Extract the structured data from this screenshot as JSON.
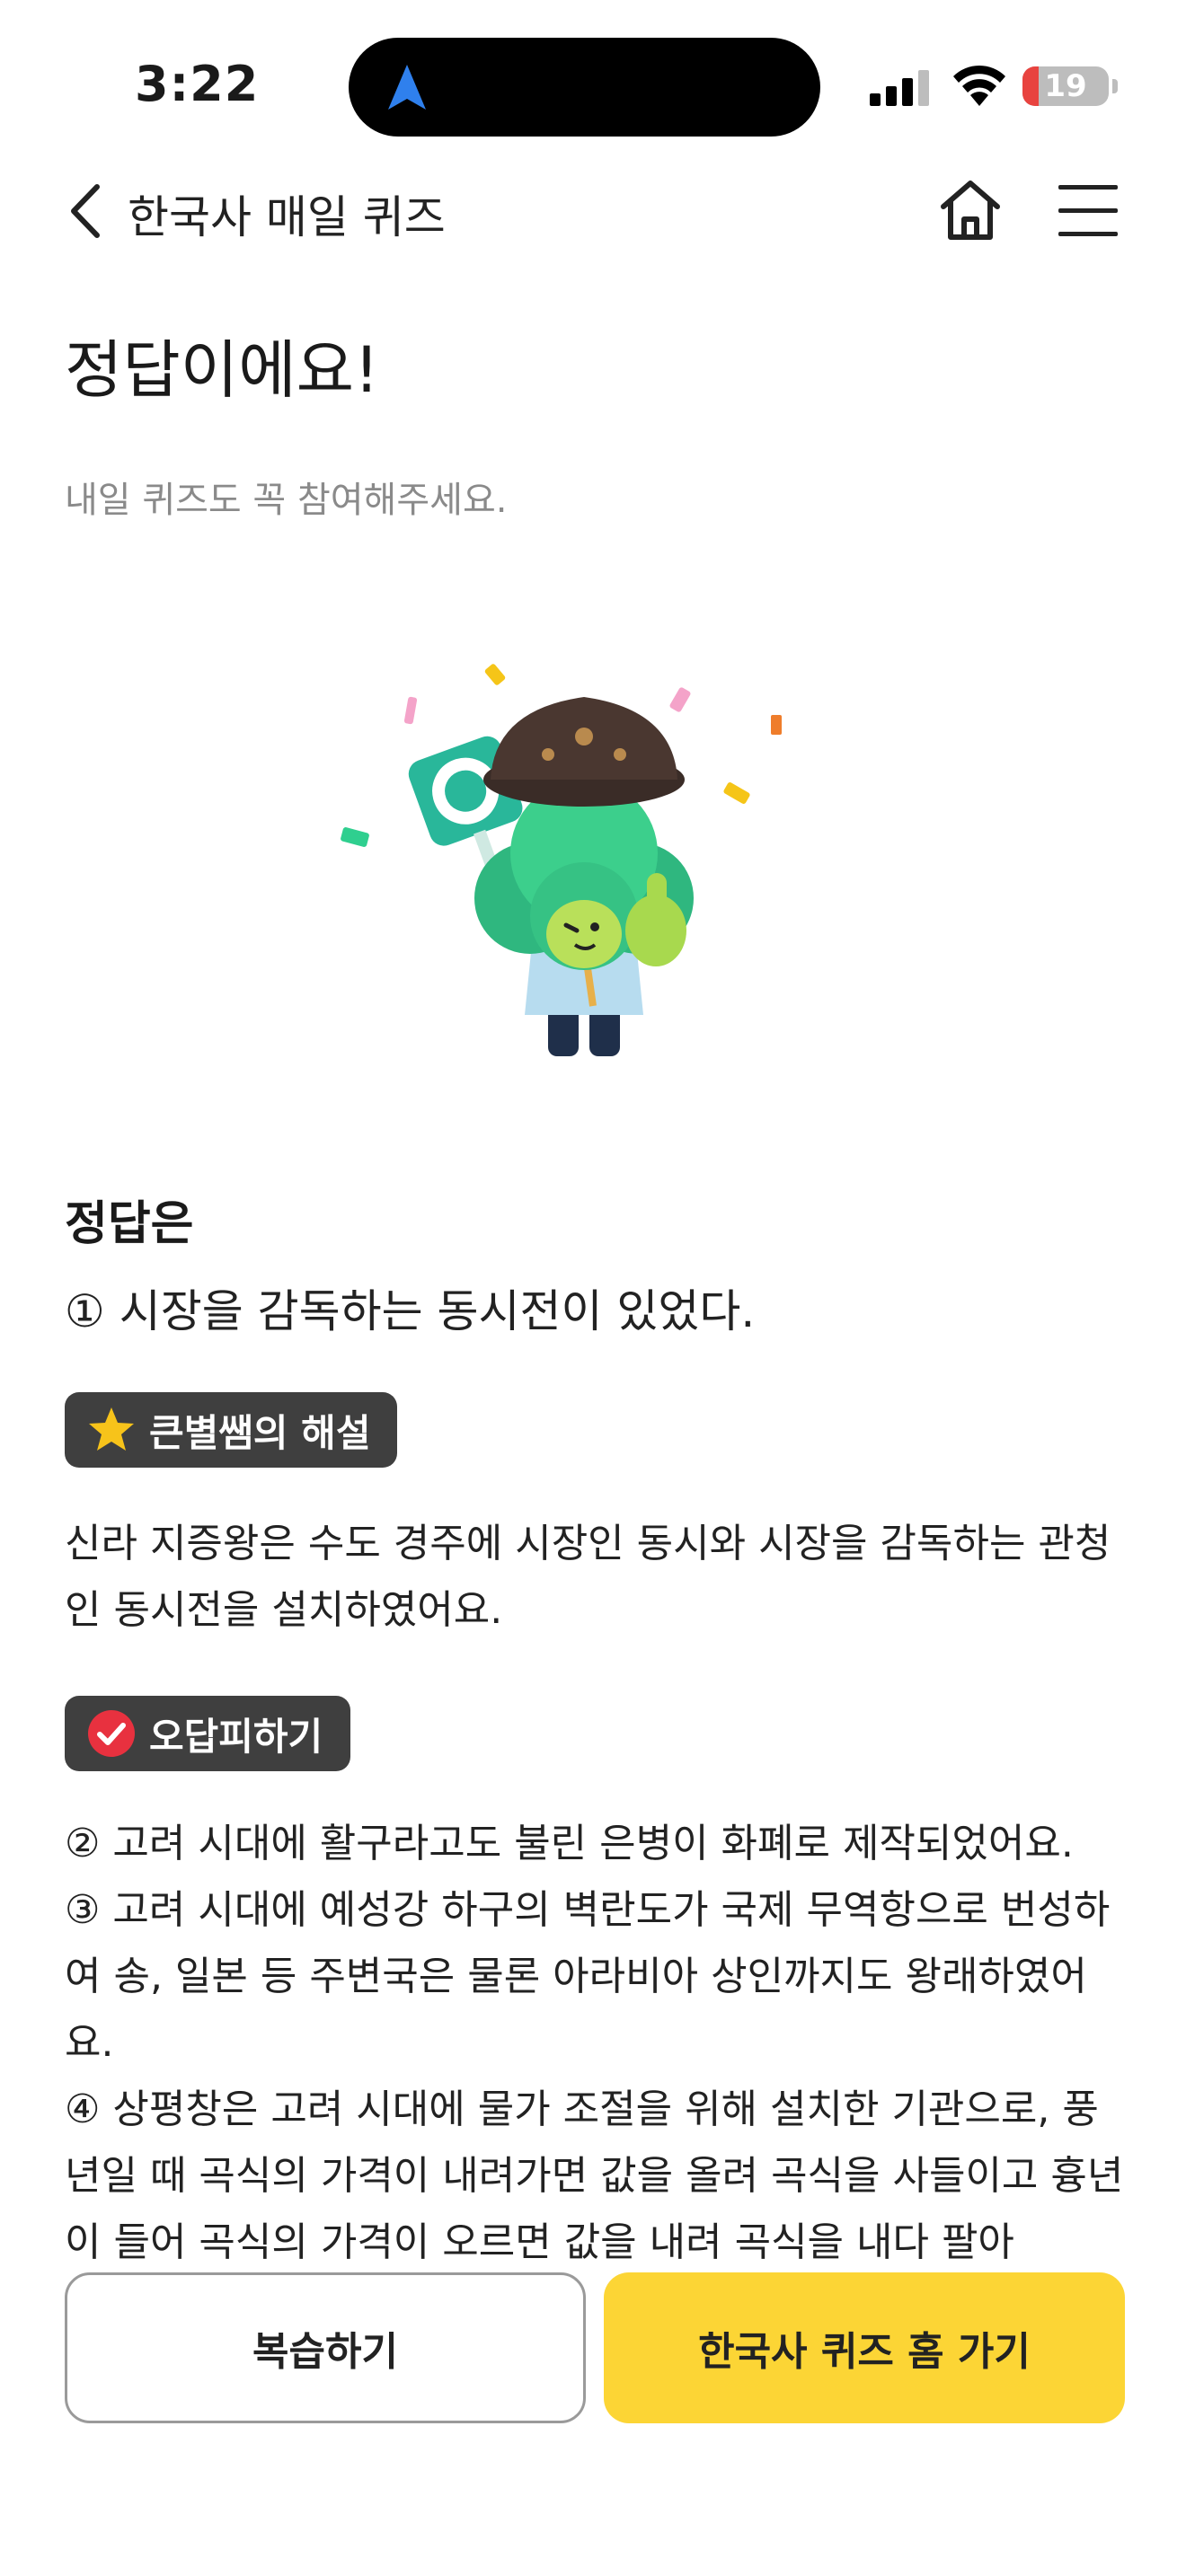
{
  "status_bar": {
    "time": "3:22",
    "battery_level": "19",
    "battery_percent": 19,
    "icons": [
      "location-arrow-icon",
      "cellular-signal-icon",
      "wifi-icon",
      "battery-icon"
    ]
  },
  "nav": {
    "title": "한국사 매일 퀴즈",
    "icons": [
      "back-chevron-icon",
      "home-icon",
      "hamburger-menu-icon"
    ]
  },
  "result": {
    "headline": "정답이에요!",
    "subline": "내일 퀴즈도 꼭 참여해주세요."
  },
  "answer": {
    "label": "정답은",
    "text": "① 시장을 감독하는 동시전이 있었다."
  },
  "explanation": {
    "badge": "큰별쌤의 해설",
    "badge_icon": "star-icon",
    "text": "신라 지증왕은 수도 경주에 시장인 동시와 시장을 감독하는 관청인 동시전을 설치하였어요."
  },
  "wrong_answers": {
    "badge": "오답피하기",
    "badge_icon": "check-circle-icon",
    "items": [
      "② 고려 시대에 활구라고도 불린 은병이 화폐로 제작되었어요.",
      "③ 고려 시대에 예성강 하구의 벽란도가 국제 무역항으로 번성하여 송, 일본 등 주변국은 물론 아라비아 상인까지도 왕래하였어요.",
      "④ 상평창은 고려 시대에 물가 조절을 위해 설치한 기관으로, 풍년일 때 곡식의 가격이 내려가면 값을 올려 곡식을 사들이고 흉년이 들어 곡식의 가격이 오르면 값을 내려 곡식을 내다 팔아"
    ]
  },
  "buttons": {
    "review": "복습하기",
    "home": "한국사 퀴즈 홈 가기"
  },
  "colors": {
    "accent_yellow": "#fcd535",
    "badge_dark": "#3f3f3f",
    "battery_red": "#e8433f",
    "location_blue": "#2f80ed"
  }
}
